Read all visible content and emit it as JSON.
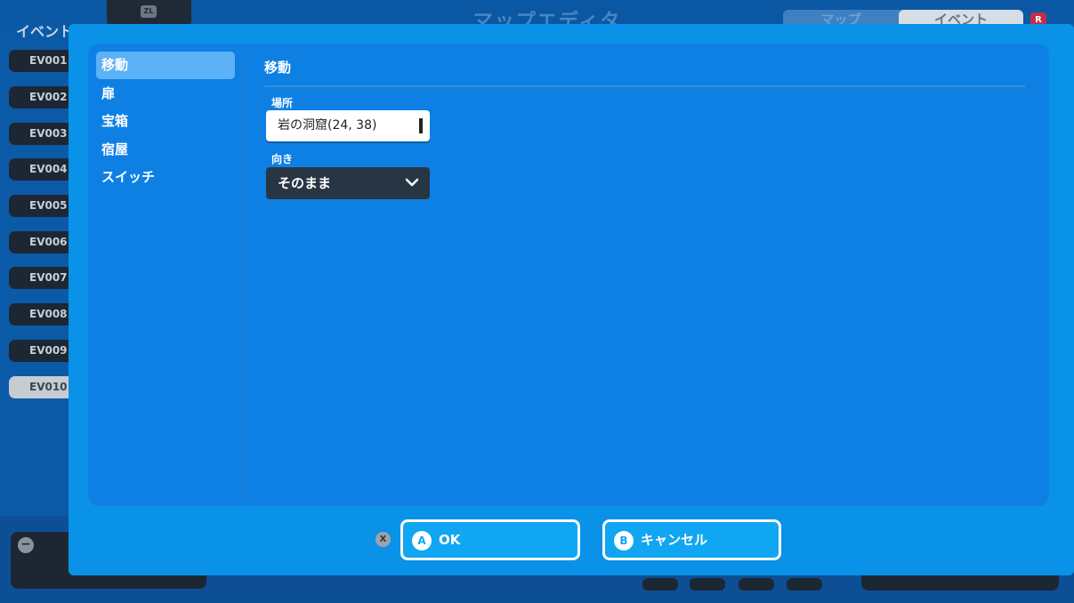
{
  "background": {
    "title": "マップエディタ",
    "zl_badge": "ZL",
    "tabs": [
      "マップ",
      "イベント"
    ],
    "r_badge": "R",
    "sidebar_label": "イベント",
    "events": [
      "EV001",
      "EV002",
      "EV003",
      "EV004",
      "EV005",
      "EV006",
      "EV007",
      "EV008",
      "EV009",
      "EV010"
    ],
    "selected_event": "EV010",
    "minus_badge": "−"
  },
  "dialog": {
    "categories": [
      {
        "label": "移動",
        "active": true
      },
      {
        "label": "扉",
        "active": false
      },
      {
        "label": "宝箱",
        "active": false
      },
      {
        "label": "宿屋",
        "active": false
      },
      {
        "label": "スイッチ",
        "active": false
      }
    ],
    "section_title": "移動",
    "location": {
      "label": "場所",
      "value": "岩の洞窟(24, 38)"
    },
    "direction": {
      "label": "向き",
      "value": "そのまま"
    },
    "x_badge": "X",
    "ok_button": {
      "key": "A",
      "label": "OK"
    },
    "cancel_button": {
      "key": "B",
      "label": "キャンセル"
    }
  }
}
